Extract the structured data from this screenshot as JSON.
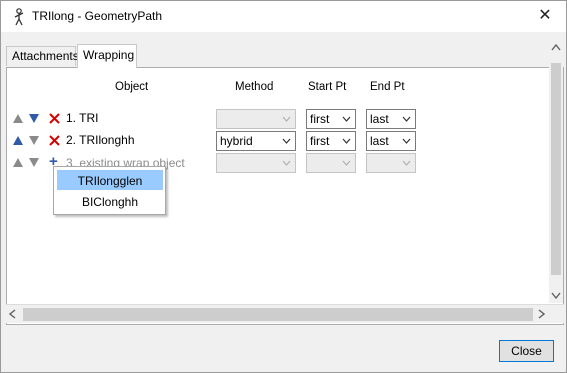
{
  "window": {
    "title": "TRIlong - GeometryPath",
    "close_glyph": "✕"
  },
  "tabs": [
    {
      "label": "Attachments",
      "active": false
    },
    {
      "label": "Wrapping",
      "active": true
    }
  ],
  "columns": {
    "object": "Object",
    "method": "Method",
    "start_pt": "Start Pt",
    "end_pt": "End Pt"
  },
  "rows": [
    {
      "label": "1. TRI",
      "method": "",
      "method_enabled": false,
      "start": "first",
      "end": "last",
      "up_enabled": false,
      "down_enabled": true
    },
    {
      "label": "2. TRIlonghh",
      "method": "hybrid",
      "method_enabled": true,
      "start": "first",
      "end": "last",
      "up_enabled": true,
      "down_enabled": false
    }
  ],
  "add_row": {
    "label": "3. existing wrap object",
    "plus": "+"
  },
  "popup_items": [
    "TRIlongglen",
    "BIClonghh"
  ],
  "buttons": {
    "close": "Close"
  },
  "colors": {
    "accent": "#0078d7",
    "delete_red": "#d40000",
    "arrow_blue": "#2e5aa8",
    "arrow_gray": "#8a8a8a",
    "selection": "#99cbff"
  },
  "icons": {
    "app": "stick-figure-icon",
    "delete": "x-icon",
    "add": "plus-icon",
    "move_up": "triangle-up-icon",
    "move_down": "triangle-down-icon",
    "dropdown": "chevron-down-icon"
  }
}
